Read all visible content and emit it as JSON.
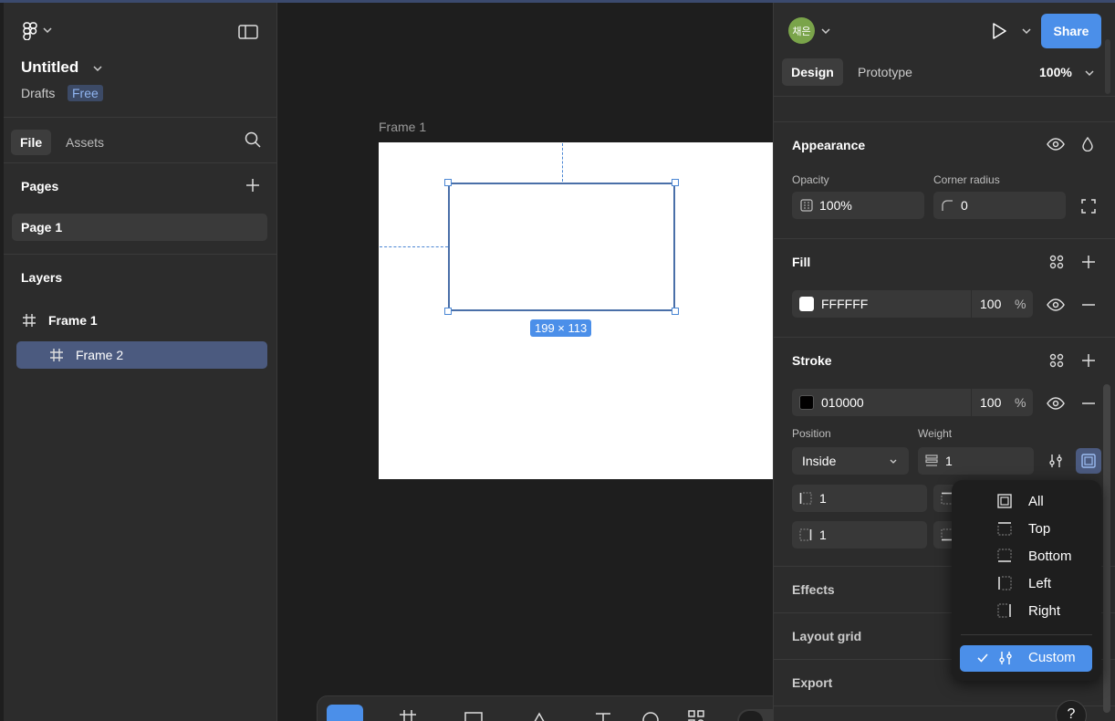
{
  "file": {
    "name": "Untitled",
    "location": "Drafts",
    "plan_badge": "Free"
  },
  "left_tabs": {
    "file": "File",
    "assets": "Assets"
  },
  "pages": {
    "header": "Pages",
    "items": [
      "Page 1"
    ]
  },
  "layers": {
    "header": "Layers",
    "items": [
      {
        "name": "Frame 1"
      },
      {
        "name": "Frame 2"
      }
    ]
  },
  "canvas": {
    "frame_label": "Frame 1",
    "size_label": "199 × 113"
  },
  "header": {
    "avatar": "채은",
    "share": "Share",
    "zoom": "100%"
  },
  "right_tabs": {
    "design": "Design",
    "prototype": "Prototype"
  },
  "appearance": {
    "title": "Appearance",
    "opacity_label": "Opacity",
    "opacity": "100%",
    "radius_label": "Corner radius",
    "radius": "0"
  },
  "fill": {
    "title": "Fill",
    "hex": "FFFFFF",
    "opacity": "100",
    "unit": "%",
    "swatch": "#FFFFFF"
  },
  "stroke": {
    "title": "Stroke",
    "hex": "010000",
    "opacity": "100",
    "unit": "%",
    "swatch": "#010000",
    "position_label": "Position",
    "position": "Inside",
    "weight_label": "Weight",
    "weight": "1",
    "side_left": "1",
    "side_right": "1"
  },
  "sections": {
    "effects": "Effects",
    "layout_grid": "Layout grid",
    "export": "Export"
  },
  "stroke_menu": {
    "items": [
      "All",
      "Top",
      "Bottom",
      "Left",
      "Right"
    ],
    "custom": "Custom"
  },
  "colors": {
    "accent": "#4b8fe9",
    "selected_layer": "#4b5a7f",
    "blue_line": "#4a86d4"
  },
  "help": "?"
}
